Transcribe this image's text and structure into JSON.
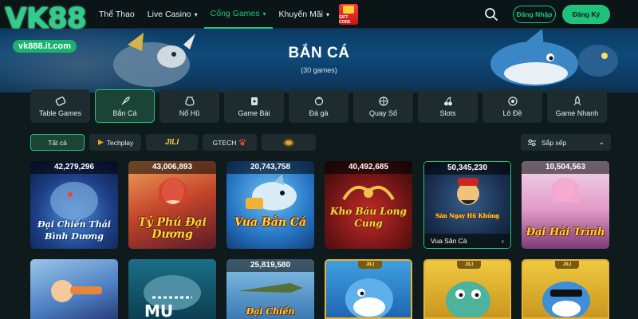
{
  "logo": {
    "text": "VK88",
    "domain": "vk888.it.com"
  },
  "nav": {
    "items": [
      {
        "label": "Thể Thao",
        "caret": ""
      },
      {
        "label": "Live Casino",
        "caret": "⌄"
      },
      {
        "label": "Cổng Games",
        "caret": "⌄",
        "active": true
      },
      {
        "label": "Khuyến Mãi",
        "caret": "⌄"
      }
    ],
    "gift_label": "GIFT CODE",
    "login": "Đăng Nhập",
    "register": "Đăng Ký"
  },
  "hero": {
    "title": "BẮN CÁ",
    "subtitle": "(30 games)"
  },
  "categories": [
    {
      "label": "Table Games",
      "icon": "ticket-icon"
    },
    {
      "label": "Bắn Cá",
      "icon": "rocket-icon",
      "active": true
    },
    {
      "label": "Nổ Hũ",
      "icon": "jar-icon"
    },
    {
      "label": "Game Bài",
      "icon": "cards-icon"
    },
    {
      "label": "Đá gà",
      "icon": "rooster-icon"
    },
    {
      "label": "Quay Số",
      "icon": "wheel-icon"
    },
    {
      "label": "Slots",
      "icon": "cherry-icon"
    },
    {
      "label": "Lô Đề",
      "icon": "ball-icon"
    },
    {
      "label": "Game Nhanh",
      "icon": "rocket-up-icon"
    }
  ],
  "providers": [
    {
      "label": "Tất cả",
      "active": true
    },
    {
      "label": "Techplay"
    },
    {
      "label": "JILI"
    },
    {
      "label": "GTECH"
    },
    {
      "label": ""
    }
  ],
  "sort": {
    "label": "Sắp xếp"
  },
  "games_row1": [
    {
      "jackpot": "42,279,296",
      "title": "Đại Chiến Thái Bình Dương"
    },
    {
      "jackpot": "43,006,893",
      "title": "Tỷ Phú Đại Dương"
    },
    {
      "jackpot": "20,743,758",
      "title": "Vua Bắn Cá"
    },
    {
      "jackpot": "40,492,685",
      "title": "Kho Báu Long Cung"
    },
    {
      "jackpot": "50,345,230",
      "title": "Săn Ngay Hũ Khủng",
      "caption": "Vua Săn Cá"
    },
    {
      "jackpot": "10,504,563",
      "title": "Đại Hải Trình"
    }
  ],
  "games_row2": [
    {
      "jackpot": "",
      "title": ""
    },
    {
      "jackpot": "",
      "title": ""
    },
    {
      "jackpot": "25,819,580",
      "title": "Đại Chiến"
    },
    {
      "jackpot": "",
      "title": "",
      "tag": "JILI"
    },
    {
      "jackpot": "",
      "title": "",
      "tag": "JILI"
    },
    {
      "jackpot": "",
      "title": "",
      "tag": "JILI"
    }
  ],
  "colors": {
    "accent": "#21c47e",
    "bg": "#0f1a1d",
    "tab": "#1e2c30"
  }
}
